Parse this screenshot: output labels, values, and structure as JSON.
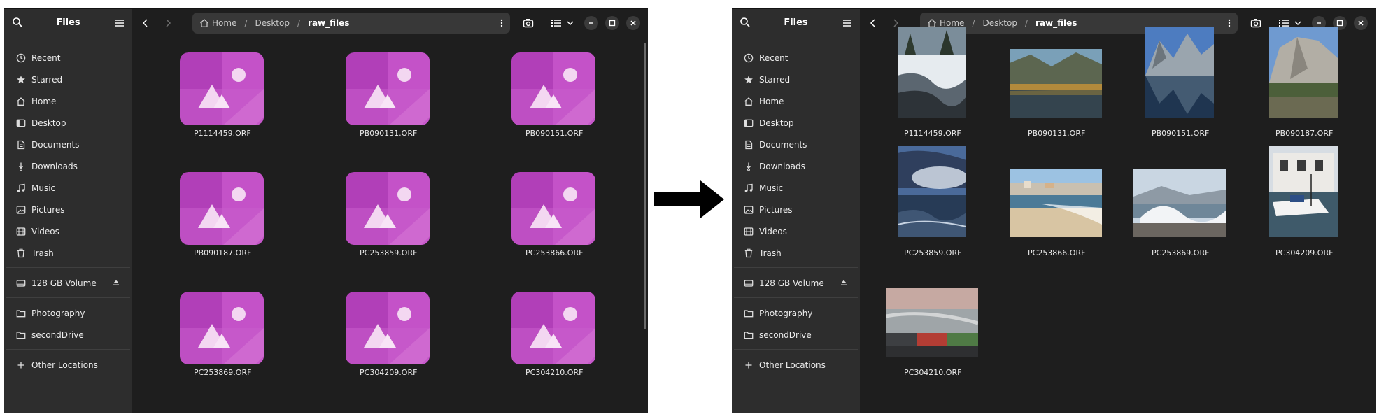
{
  "app": {
    "title": "Files"
  },
  "sidebar": {
    "places": [
      {
        "label": "Recent",
        "icon": "clock-icon"
      },
      {
        "label": "Starred",
        "icon": "star-icon"
      },
      {
        "label": "Home",
        "icon": "home-icon"
      },
      {
        "label": "Desktop",
        "icon": "desktop-icon"
      },
      {
        "label": "Documents",
        "icon": "document-icon"
      },
      {
        "label": "Downloads",
        "icon": "download-icon"
      },
      {
        "label": "Music",
        "icon": "music-icon"
      },
      {
        "label": "Pictures",
        "icon": "picture-icon"
      },
      {
        "label": "Videos",
        "icon": "video-icon"
      },
      {
        "label": "Trash",
        "icon": "trash-icon"
      }
    ],
    "devices": [
      {
        "label": "128 GB Volume",
        "icon": "drive-icon"
      }
    ],
    "bookmarks": [
      {
        "label": "Photography",
        "icon": "folder-icon"
      },
      {
        "label": "secondDrive",
        "icon": "folder-icon"
      }
    ],
    "other": {
      "label": "Other Locations",
      "icon": "plus-icon"
    }
  },
  "pathbar": {
    "crumbs": [
      "Home",
      "Desktop",
      "raw_files"
    ]
  },
  "files": [
    "P1114459.ORF",
    "PB090131.ORF",
    "PB090151.ORF",
    "PB090187.ORF",
    "PC253859.ORF",
    "PC253866.ORF",
    "PC253869.ORF",
    "PC304209.ORF",
    "PC304210.ORF"
  ],
  "colors": {
    "window_bg": "#1e1e1e",
    "sidebar_bg": "#2d2d2d",
    "placeholder_purple": "#c04ac4",
    "pathbar_bg": "#383838"
  }
}
